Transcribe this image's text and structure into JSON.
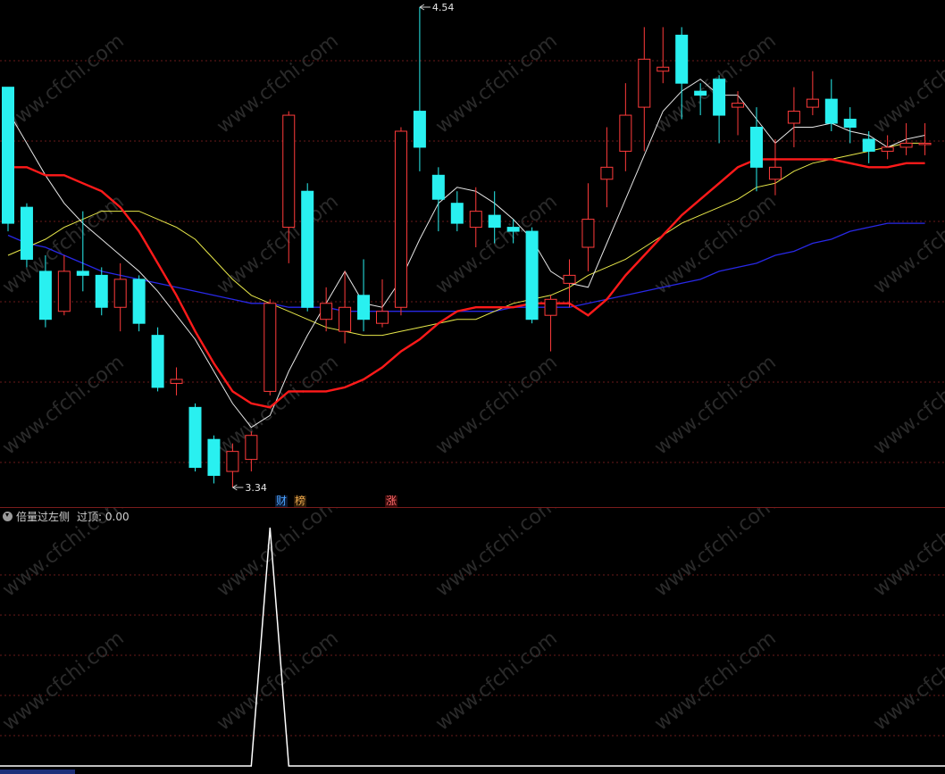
{
  "candles": [
    {
      "o": 4.34,
      "c": 4.0,
      "h": 4.34,
      "l": 3.98
    },
    {
      "o": 4.04,
      "c": 3.91,
      "h": 4.05,
      "l": 3.89
    },
    {
      "o": 3.88,
      "c": 3.76,
      "h": 3.92,
      "l": 3.74
    },
    {
      "o": 3.78,
      "c": 3.88,
      "h": 3.92,
      "l": 3.77
    },
    {
      "o": 3.88,
      "c": 3.87,
      "h": 4.03,
      "l": 3.83
    },
    {
      "o": 3.87,
      "c": 3.79,
      "h": 3.89,
      "l": 3.77
    },
    {
      "o": 3.79,
      "c": 3.86,
      "h": 3.9,
      "l": 3.73
    },
    {
      "o": 3.86,
      "c": 3.75,
      "h": 3.87,
      "l": 3.73
    },
    {
      "o": 3.72,
      "c": 3.59,
      "h": 3.74,
      "l": 3.58
    },
    {
      "o": 3.6,
      "c": 3.61,
      "h": 3.64,
      "l": 3.57
    },
    {
      "o": 3.54,
      "c": 3.39,
      "h": 3.55,
      "l": 3.38
    },
    {
      "o": 3.46,
      "c": 3.37,
      "h": 3.47,
      "l": 3.35
    },
    {
      "o": 3.38,
      "c": 3.43,
      "h": 3.45,
      "l": 3.34
    },
    {
      "o": 3.41,
      "c": 3.47,
      "h": 3.48,
      "l": 3.38
    },
    {
      "o": 3.58,
      "c": 3.8,
      "h": 3.81,
      "l": 3.57
    },
    {
      "o": 3.99,
      "c": 4.27,
      "h": 4.28,
      "l": 3.9
    },
    {
      "o": 4.08,
      "c": 3.79,
      "h": 4.1,
      "l": 3.78
    },
    {
      "o": 3.76,
      "c": 3.8,
      "h": 3.84,
      "l": 3.73
    },
    {
      "o": 3.73,
      "c": 3.79,
      "h": 3.88,
      "l": 3.7
    },
    {
      "o": 3.82,
      "c": 3.76,
      "h": 3.91,
      "l": 3.73
    },
    {
      "o": 3.75,
      "c": 3.78,
      "h": 3.86,
      "l": 3.74
    },
    {
      "o": 3.79,
      "c": 4.23,
      "h": 4.24,
      "l": 3.77
    },
    {
      "o": 4.28,
      "c": 4.19,
      "h": 4.54,
      "l": 4.13
    },
    {
      "o": 4.12,
      "c": 4.06,
      "h": 4.14,
      "l": 3.98
    },
    {
      "o": 4.05,
      "c": 4.0,
      "h": 4.08,
      "l": 3.98
    },
    {
      "o": 3.99,
      "c": 4.03,
      "h": 4.09,
      "l": 3.94
    },
    {
      "o": 4.02,
      "c": 3.99,
      "h": 4.08,
      "l": 3.95
    },
    {
      "o": 3.99,
      "c": 3.98,
      "h": 4.01,
      "l": 3.95
    },
    {
      "o": 3.98,
      "c": 3.76,
      "h": 3.99,
      "l": 3.75
    },
    {
      "o": 3.77,
      "c": 3.81,
      "h": 3.82,
      "l": 3.68
    },
    {
      "o": 3.85,
      "c": 3.87,
      "h": 3.91,
      "l": 3.79
    },
    {
      "o": 3.94,
      "c": 4.01,
      "h": 4.1,
      "l": 3.88
    },
    {
      "o": 4.11,
      "c": 4.14,
      "h": 4.24,
      "l": 4.04
    },
    {
      "o": 4.18,
      "c": 4.27,
      "h": 4.35,
      "l": 4.13
    },
    {
      "o": 4.29,
      "c": 4.41,
      "h": 4.49,
      "l": 4.18
    },
    {
      "o": 4.38,
      "c": 4.39,
      "h": 4.49,
      "l": 4.35
    },
    {
      "o": 4.47,
      "c": 4.35,
      "h": 4.49,
      "l": 4.26
    },
    {
      "o": 4.33,
      "c": 4.32,
      "h": 4.35,
      "l": 4.27
    },
    {
      "o": 4.36,
      "c": 4.27,
      "h": 4.37,
      "l": 4.2
    },
    {
      "o": 4.29,
      "c": 4.3,
      "h": 4.33,
      "l": 4.22
    },
    {
      "o": 4.24,
      "c": 4.14,
      "h": 4.29,
      "l": 4.08
    },
    {
      "o": 4.11,
      "c": 4.14,
      "h": 4.21,
      "l": 4.07
    },
    {
      "o": 4.25,
      "c": 4.28,
      "h": 4.34,
      "l": 4.19
    },
    {
      "o": 4.29,
      "c": 4.31,
      "h": 4.38,
      "l": 4.27
    },
    {
      "o": 4.31,
      "c": 4.25,
      "h": 4.36,
      "l": 4.23
    },
    {
      "o": 4.26,
      "c": 4.24,
      "h": 4.29,
      "l": 4.2
    },
    {
      "o": 4.21,
      "c": 4.18,
      "h": 4.23,
      "l": 4.15
    },
    {
      "o": 4.18,
      "c": 4.19,
      "h": 4.22,
      "l": 4.16
    },
    {
      "o": 4.19,
      "c": 4.2,
      "h": 4.25,
      "l": 4.17
    },
    {
      "o": 4.2,
      "c": 4.2,
      "h": 4.25,
      "l": 4.17
    }
  ],
  "ma_white": [
    4.28,
    4.2,
    4.12,
    4.05,
    4.0,
    3.96,
    3.92,
    3.88,
    3.83,
    3.77,
    3.71,
    3.63,
    3.55,
    3.49,
    3.52,
    3.63,
    3.72,
    3.8,
    3.88,
    3.8,
    3.79,
    3.86,
    3.96,
    4.05,
    4.09,
    4.08,
    4.05,
    4.01,
    3.96,
    3.88,
    3.85,
    3.84,
    3.95,
    4.06,
    4.17,
    4.28,
    4.33,
    4.36,
    4.32,
    4.32,
    4.26,
    4.2,
    4.24,
    4.24,
    4.25,
    4.23,
    4.22,
    4.19,
    4.21,
    4.22
  ],
  "ma_red": [
    4.14,
    4.14,
    4.12,
    4.12,
    4.1,
    4.08,
    4.04,
    3.98,
    3.9,
    3.82,
    3.73,
    3.65,
    3.58,
    3.55,
    3.54,
    3.58,
    3.58,
    3.58,
    3.59,
    3.61,
    3.64,
    3.68,
    3.71,
    3.75,
    3.78,
    3.79,
    3.79,
    3.79,
    3.8,
    3.8,
    3.8,
    3.77,
    3.81,
    3.87,
    3.92,
    3.97,
    4.02,
    4.06,
    4.1,
    4.14,
    4.16,
    4.16,
    4.16,
    4.16,
    4.16,
    4.15,
    4.14,
    4.14,
    4.15,
    4.15
  ],
  "ma_yellow": [
    3.92,
    3.94,
    3.96,
    3.99,
    4.01,
    4.03,
    4.03,
    4.03,
    4.01,
    3.99,
    3.96,
    3.91,
    3.86,
    3.82,
    3.8,
    3.78,
    3.76,
    3.74,
    3.73,
    3.72,
    3.72,
    3.73,
    3.74,
    3.75,
    3.76,
    3.76,
    3.78,
    3.8,
    3.81,
    3.82,
    3.84,
    3.87,
    3.89,
    3.91,
    3.94,
    3.97,
    4.0,
    4.02,
    4.04,
    4.06,
    4.09,
    4.1,
    4.13,
    4.15,
    4.16,
    4.17,
    4.18,
    4.19,
    4.2,
    4.2
  ],
  "ma_blue": [
    3.97,
    3.95,
    3.94,
    3.92,
    3.9,
    3.88,
    3.87,
    3.86,
    3.85,
    3.84,
    3.83,
    3.82,
    3.81,
    3.8,
    3.8,
    3.79,
    3.79,
    3.79,
    3.78,
    3.78,
    3.78,
    3.78,
    3.78,
    3.78,
    3.78,
    3.78,
    3.78,
    3.79,
    3.79,
    3.79,
    3.79,
    3.8,
    3.81,
    3.82,
    3.83,
    3.84,
    3.85,
    3.86,
    3.88,
    3.89,
    3.9,
    3.92,
    3.93,
    3.95,
    3.96,
    3.98,
    3.99,
    4.0,
    4.0,
    4.0
  ],
  "signal": [
    0,
    0,
    0,
    0,
    0,
    0,
    0,
    0,
    0,
    0,
    0,
    0,
    0,
    0,
    1,
    0,
    0,
    0,
    0,
    0,
    0,
    0,
    0,
    0,
    0,
    0,
    0,
    0,
    0,
    0,
    0,
    0,
    0,
    0,
    0,
    0,
    0,
    0,
    0,
    0,
    0,
    0,
    0,
    0,
    0,
    0,
    0,
    0,
    0,
    0
  ],
  "high_label": "4.54",
  "low_label": "3.34",
  "badges": [
    {
      "text": "财",
      "color": "#4aa3ff",
      "bg": "#0c1a33"
    },
    {
      "text": "榜",
      "color": "#e8a64a",
      "bg": "#2a1a08"
    },
    {
      "text": "涨",
      "color": "#ff6a6a",
      "bg": "#3a0a0a"
    }
  ],
  "indicator": {
    "name": "倍量过左侧",
    "value_label": "过顶: 0.00"
  },
  "watermark": "www.cfchi.com",
  "colors": {
    "up": "#ff3b3b",
    "down": "#29f0f0",
    "ma_white": "#e6e6e6",
    "ma_red": "#ff1a1a",
    "ma_yellow": "#e8e84a",
    "ma_blue": "#2828e6",
    "grid": "#6a1a1a",
    "signal": "#ffffff"
  }
}
